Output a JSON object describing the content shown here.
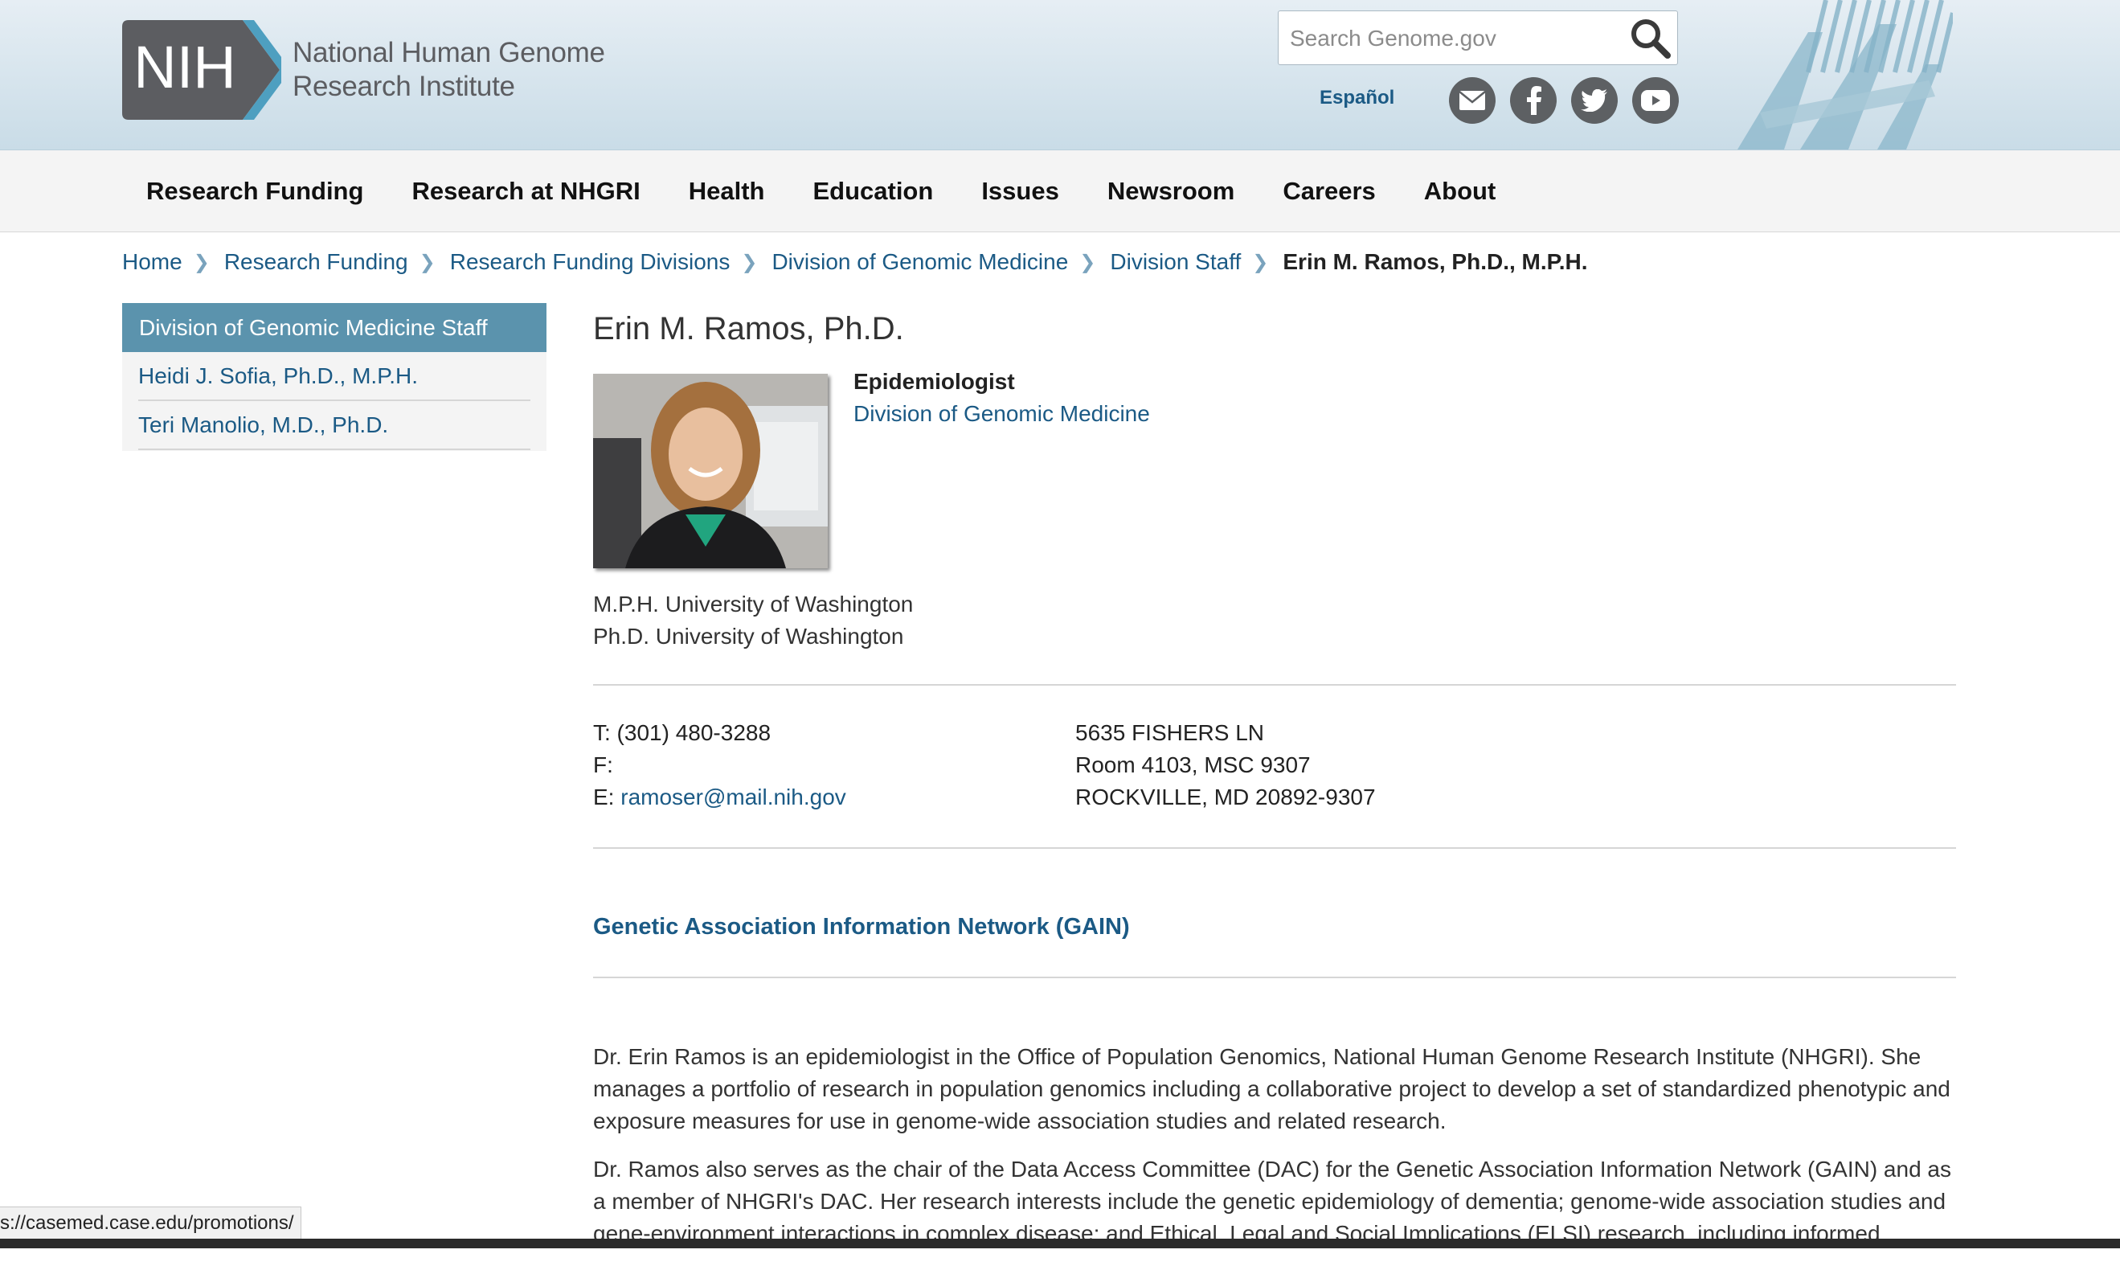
{
  "header": {
    "logo_letters": "NIH",
    "logo_line1": "National Human Genome",
    "logo_line2": "Research Institute",
    "search_placeholder": "Search Genome.gov",
    "espanol": "Español",
    "social_icons": [
      "email-icon",
      "facebook-icon",
      "twitter-icon",
      "youtube-icon"
    ],
    "colors": {
      "header_bg": "#d5e4ec",
      "logo_gray": "#5c5d61",
      "logo_blue": "#4e9fc0",
      "link": "#1b5a85"
    }
  },
  "nav": {
    "items": [
      "Research Funding",
      "Research at NHGRI",
      "Health",
      "Education",
      "Issues",
      "Newsroom",
      "Careers",
      "About"
    ]
  },
  "breadcrumb": {
    "items": [
      "Home",
      "Research Funding",
      "Research Funding Divisions",
      "Division of Genomic Medicine",
      "Division Staff"
    ],
    "current": "Erin M. Ramos, Ph.D., M.P.H."
  },
  "sidebar": {
    "heading": "Division of Genomic Medicine Staff",
    "items": [
      "Heidi J. Sofia, Ph.D., M.P.H.",
      "Teri Manolio, M.D., Ph.D."
    ],
    "colors": {
      "heading_bg": "#5b93ad"
    }
  },
  "profile": {
    "name": "Erin M. Ramos, Ph.D.",
    "job_title": "Epidemiologist",
    "division": "Division of Genomic Medicine",
    "degrees": [
      "M.P.H. University of Washington",
      "Ph.D. University of Washington"
    ],
    "phone": "T: (301) 480-3288",
    "fax": "F:",
    "email_label": "E:",
    "email": "ramoser@mail.nih.gov",
    "address": [
      "5635 FISHERS LN",
      "Room 4103, MSC 9307",
      "ROCKVILLE, MD 20892-9307"
    ],
    "project_link": "Genetic Association Information Network (GAIN)",
    "bio": [
      "Dr. Erin Ramos is an epidemiologist in the Office of Population Genomics, National Human Genome Research Institute (NHGRI). She manages a portfolio of research in population genomics including a collaborative project to develop a set of standardized phenotypic and exposure measures for use in genome-wide association studies and related research.",
      "Dr. Ramos also serves as the chair of the Data Access Committee (DAC) for the Genetic Association Information Network (GAIN) and as a member of NHGRI's DAC. Her research interests include the genetic epidemiology of dementia; genome-wide association studies and gene-environment interactions in complex disease; and Ethical, Legal and Social Implications (ELSI) research, including informed"
    ]
  },
  "status_bar": {
    "url": "s://casemed.case.edu/promotions/"
  }
}
